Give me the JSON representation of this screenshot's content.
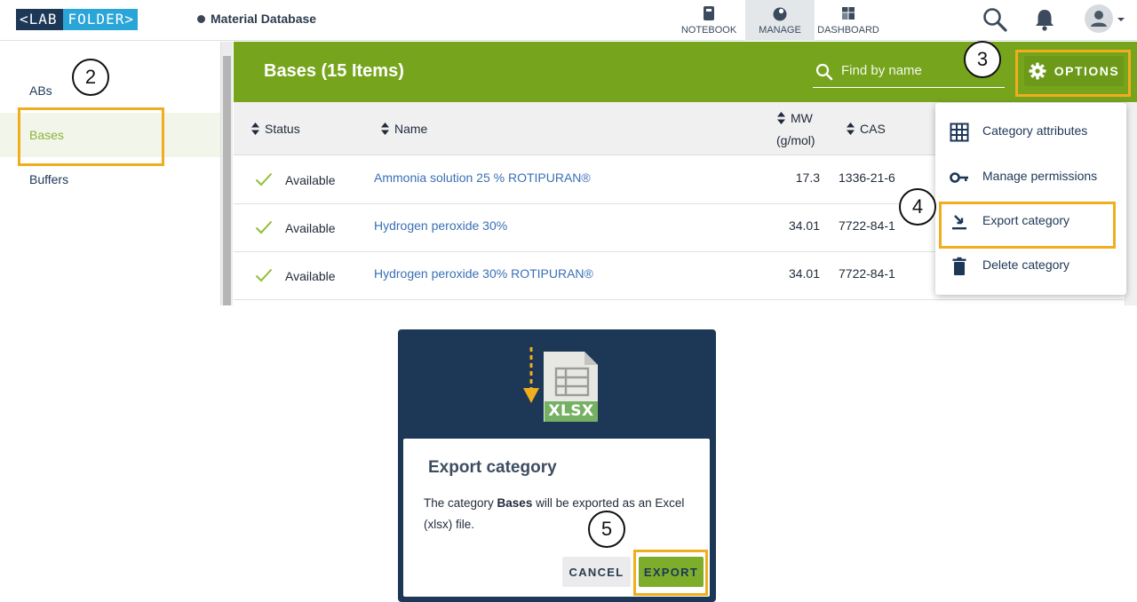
{
  "brand": {
    "logo_left": "<LAB",
    "logo_right": "FOLDER>"
  },
  "header": {
    "db_title": "Material Database"
  },
  "nav": [
    {
      "label": "NOTEBOOK",
      "icon": "notebook-icon"
    },
    {
      "label": "MANAGE",
      "icon": "manage-icon",
      "active": true
    },
    {
      "label": "DASHBOARD",
      "icon": "dashboard-icon"
    }
  ],
  "top_icons": [
    "search-icon",
    "bell-icon",
    "avatar"
  ],
  "sidebar": {
    "items": [
      {
        "label": "ABs"
      },
      {
        "label": "Bases",
        "active": true
      },
      {
        "label": "Buffers"
      }
    ]
  },
  "category": {
    "title": "Bases (15 Items)",
    "search_placeholder": "Find by name",
    "options_label": "OPTIONS"
  },
  "table": {
    "headers": {
      "status": "Status",
      "name": "Name",
      "mw": "MW",
      "mw_unit": "(g/mol)",
      "cas": "CAS"
    },
    "rows": [
      {
        "status": "Available",
        "name": "Ammonia solution 25 % ROTIPURAN®",
        "mw": "17.3",
        "cas": "1336-21-6"
      },
      {
        "status": "Available",
        "name": "Hydrogen peroxide 30%",
        "mw": "34.01",
        "cas": "7722-84-1"
      },
      {
        "status": "Available",
        "name": "Hydrogen peroxide 30% ROTIPURAN®",
        "mw": "34.01",
        "cas": "7722-84-1"
      }
    ]
  },
  "options_menu": {
    "items": [
      {
        "label": "Category attributes",
        "icon": "grid-icon"
      },
      {
        "label": "Manage permissions",
        "icon": "key-icon"
      },
      {
        "label": "Export category",
        "icon": "export-icon"
      },
      {
        "label": "Delete category",
        "icon": "trash-icon"
      }
    ]
  },
  "steps": {
    "s2": "2",
    "s3": "3",
    "s4": "4",
    "s5": "5"
  },
  "dialog": {
    "file_badge": "XLSX",
    "title": "Export category",
    "body_prefix": "The category ",
    "body_bold": "Bases",
    "body_suffix": " will be exported as an Excel (xlsx) file.",
    "cancel_label": "CANCEL",
    "export_label": "EXPORT"
  },
  "colors": {
    "accent_green": "#76a51d",
    "highlight": "#f0ad1e",
    "navy": "#1d3757",
    "link": "#3a6fb5"
  }
}
